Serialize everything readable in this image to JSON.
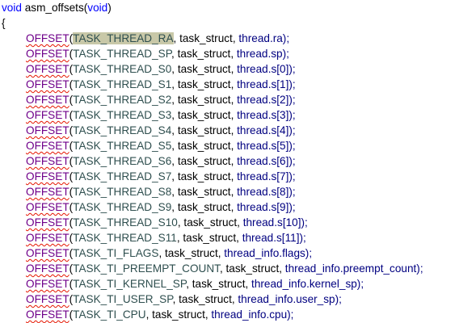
{
  "editor": {
    "signature": {
      "return_type": "void",
      "name": " asm_offsets(",
      "param": "void",
      "close": ")"
    },
    "open_brace": "{",
    "macro_name": "OFFSET",
    "lines": [
      {
        "constant": "TASK_THREAD_RA",
        "rest": ", task_struct, ",
        "member": "thread",
        "tail": ".ra);",
        "highlighted": true
      },
      {
        "constant": "TASK_THREAD_SP",
        "rest": ", task_struct, ",
        "member": "thread",
        "tail": ".sp);",
        "highlighted": false
      },
      {
        "constant": "TASK_THREAD_S0",
        "rest": ", task_struct, ",
        "member": "thread",
        "tail": ".s[0]);",
        "highlighted": false
      },
      {
        "constant": "TASK_THREAD_S1",
        "rest": ", task_struct, ",
        "member": "thread",
        "tail": ".s[1]);",
        "highlighted": false
      },
      {
        "constant": "TASK_THREAD_S2",
        "rest": ", task_struct, ",
        "member": "thread",
        "tail": ".s[2]);",
        "highlighted": false
      },
      {
        "constant": "TASK_THREAD_S3",
        "rest": ", task_struct, ",
        "member": "thread",
        "tail": ".s[3]);",
        "highlighted": false
      },
      {
        "constant": "TASK_THREAD_S4",
        "rest": ", task_struct, ",
        "member": "thread",
        "tail": ".s[4]);",
        "highlighted": false
      },
      {
        "constant": "TASK_THREAD_S5",
        "rest": ", task_struct, ",
        "member": "thread",
        "tail": ".s[5]);",
        "highlighted": false
      },
      {
        "constant": "TASK_THREAD_S6",
        "rest": ", task_struct, ",
        "member": "thread",
        "tail": ".s[6]);",
        "highlighted": false
      },
      {
        "constant": "TASK_THREAD_S7",
        "rest": ", task_struct, ",
        "member": "thread",
        "tail": ".s[7]);",
        "highlighted": false
      },
      {
        "constant": "TASK_THREAD_S8",
        "rest": ", task_struct, ",
        "member": "thread",
        "tail": ".s[8]);",
        "highlighted": false
      },
      {
        "constant": "TASK_THREAD_S9",
        "rest": ", task_struct, ",
        "member": "thread",
        "tail": ".s[9]);",
        "highlighted": false
      },
      {
        "constant": "TASK_THREAD_S10",
        "rest": ", task_struct, ",
        "member": "thread",
        "tail": ".s[10]);",
        "highlighted": false
      },
      {
        "constant": "TASK_THREAD_S11",
        "rest": ", task_struct, ",
        "member": "thread",
        "tail": ".s[11]);",
        "highlighted": false
      },
      {
        "constant": "TASK_TI_FLAGS",
        "rest": ", task_struct, ",
        "member": "thread_info",
        "tail": ".flags);",
        "highlighted": false
      },
      {
        "constant": "TASK_TI_PREEMPT_COUNT",
        "rest": ", task_struct, ",
        "member": "thread_info",
        "tail": ".preempt_count);",
        "highlighted": false
      },
      {
        "constant": "TASK_TI_KERNEL_SP",
        "rest": ", task_struct, ",
        "member": "thread_info",
        "tail": ".kernel_sp);",
        "highlighted": false
      },
      {
        "constant": "TASK_TI_USER_SP",
        "rest": ", task_struct, ",
        "member": "thread_info",
        "tail": ".user_sp);",
        "highlighted": false
      },
      {
        "constant": "TASK_TI_CPU",
        "rest": ", task_struct, ",
        "member": "thread_info",
        "tail": ".cpu);",
        "highlighted": false
      }
    ],
    "colors": {
      "keyword": "#0000ff",
      "macro": "#6f008a",
      "squiggle": "#e51400",
      "constant": "#2f4f4f",
      "highlight_bg": "#c8c8a8",
      "member": "#000080",
      "background": "#ffffff"
    }
  }
}
